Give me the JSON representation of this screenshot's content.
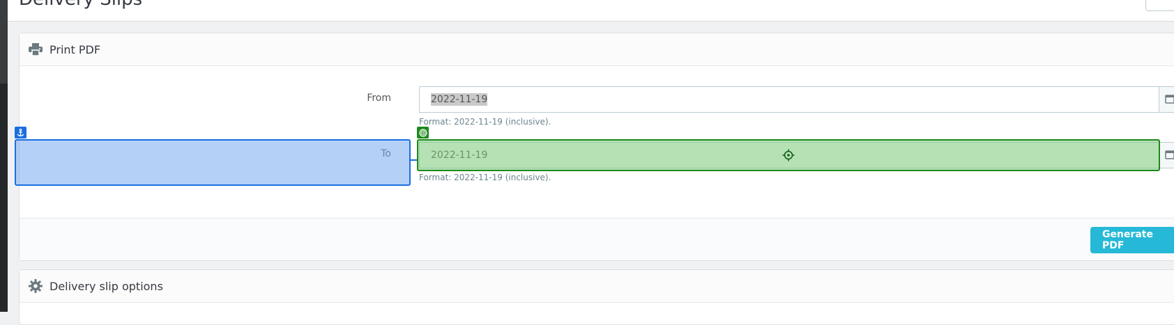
{
  "page": {
    "title": "Delivery Slips"
  },
  "print_panel": {
    "title": "Print PDF",
    "icon": "printer-icon",
    "from": {
      "label": "From",
      "value": "2022-11-19",
      "help": "Format: 2022-11-19 (inclusive).",
      "icon": "calendar-icon"
    },
    "to": {
      "label": "To",
      "value": "2022-11-19",
      "help": "Format: 2022-11-19 (inclusive).",
      "icon": "calendar-icon"
    },
    "generate_label": "Generate PDF"
  },
  "options_panel": {
    "title": "Delivery slip options",
    "icon": "gear-icon"
  },
  "overlays": {
    "anchor_icon": "anchor-icon",
    "target_icon": "target-icon",
    "crosshair_icon": "crosshair-icon",
    "anchor_color": "#1a6fe0",
    "target_color": "#1c8a1c"
  },
  "colors": {
    "accent": "#25b9d7",
    "text": "#363a41",
    "help": "#6c868e"
  }
}
